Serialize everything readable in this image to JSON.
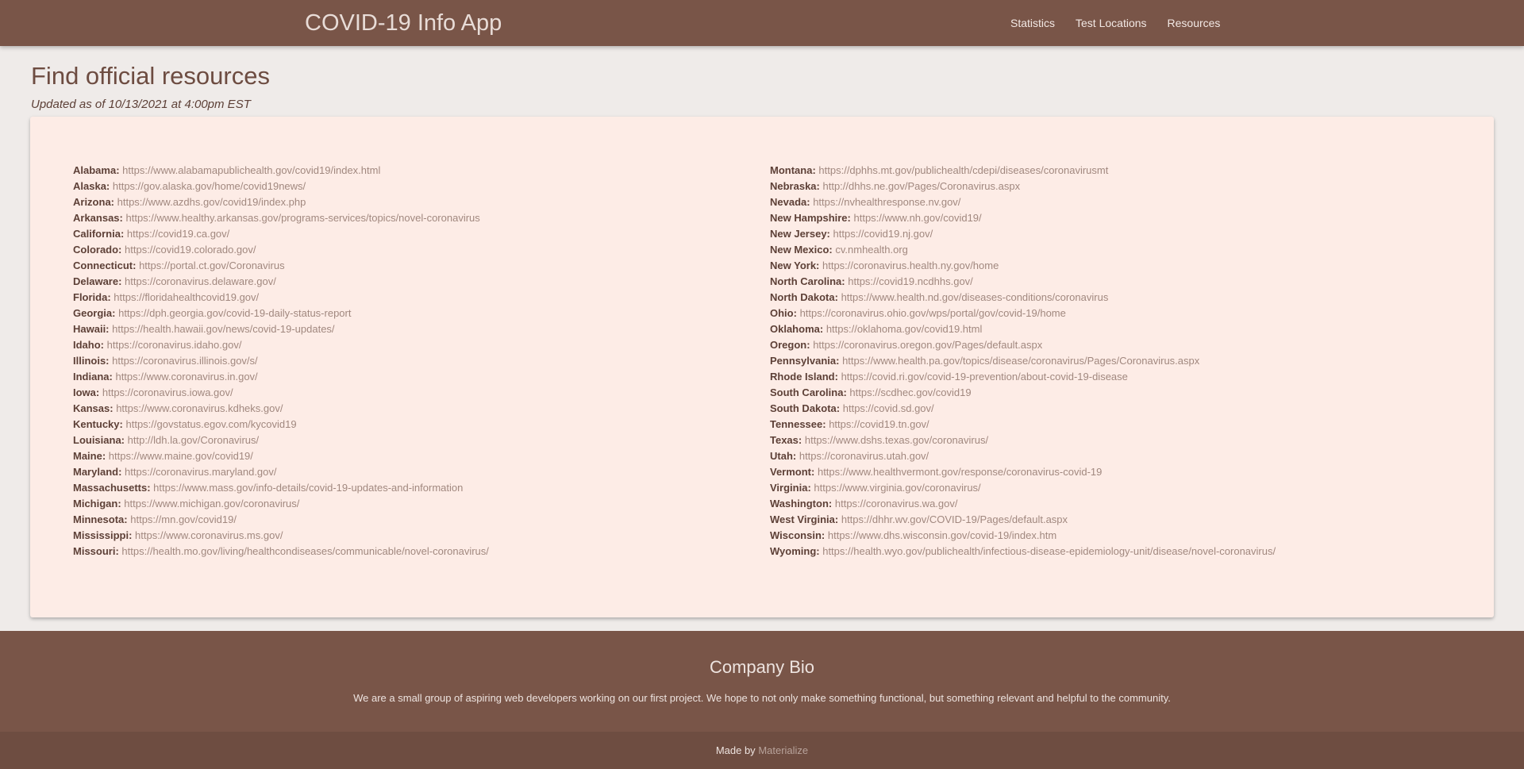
{
  "navbar": {
    "brand": "COVID-19 Info App",
    "links": [
      "Statistics",
      "Test Locations",
      "Resources"
    ]
  },
  "page": {
    "title": "Find official resources",
    "updated": "Updated as of 10/13/2021 at 4:00pm EST"
  },
  "resources": {
    "left": [
      {
        "state": "Alabama:",
        "url": "https://www.alabamapublichealth.gov/covid19/index.html"
      },
      {
        "state": "Alaska:",
        "url": "https://gov.alaska.gov/home/covid19news/"
      },
      {
        "state": "Arizona:",
        "url": "https://www.azdhs.gov/covid19/index.php"
      },
      {
        "state": "Arkansas:",
        "url": "https://www.healthy.arkansas.gov/programs-services/topics/novel-coronavirus"
      },
      {
        "state": "California:",
        "url": "https://covid19.ca.gov/"
      },
      {
        "state": "Colorado:",
        "url": "https://covid19.colorado.gov/"
      },
      {
        "state": "Connecticut:",
        "url": "https://portal.ct.gov/Coronavirus"
      },
      {
        "state": "Delaware:",
        "url": "https://coronavirus.delaware.gov/"
      },
      {
        "state": "Florida:",
        "url": "https://floridahealthcovid19.gov/"
      },
      {
        "state": "Georgia:",
        "url": "https://dph.georgia.gov/covid-19-daily-status-report"
      },
      {
        "state": "Hawaii:",
        "url": "https://health.hawaii.gov/news/covid-19-updates/"
      },
      {
        "state": "Idaho:",
        "url": "https://coronavirus.idaho.gov/"
      },
      {
        "state": "Illinois:",
        "url": "https://coronavirus.illinois.gov/s/"
      },
      {
        "state": "Indiana:",
        "url": "https://www.coronavirus.in.gov/"
      },
      {
        "state": "Iowa:",
        "url": "https://coronavirus.iowa.gov/"
      },
      {
        "state": "Kansas:",
        "url": "https://www.coronavirus.kdheks.gov/"
      },
      {
        "state": "Kentucky:",
        "url": "https://govstatus.egov.com/kycovid19"
      },
      {
        "state": "Louisiana:",
        "url": "http://ldh.la.gov/Coronavirus/"
      },
      {
        "state": "Maine:",
        "url": "https://www.maine.gov/covid19/"
      },
      {
        "state": "Maryland:",
        "url": "https://coronavirus.maryland.gov/"
      },
      {
        "state": "Massachusetts:",
        "url": "https://www.mass.gov/info-details/covid-19-updates-and-information"
      },
      {
        "state": "Michigan:",
        "url": "https://www.michigan.gov/coronavirus/"
      },
      {
        "state": "Minnesota:",
        "url": "https://mn.gov/covid19/"
      },
      {
        "state": "Mississippi:",
        "url": "https://www.coronavirus.ms.gov/"
      },
      {
        "state": "Missouri:",
        "url": "https://health.mo.gov/living/healthcondiseases/communicable/novel-coronavirus/"
      }
    ],
    "right": [
      {
        "state": "Montana:",
        "url": "https://dphhs.mt.gov/publichealth/cdepi/diseases/coronavirusmt"
      },
      {
        "state": "Nebraska:",
        "url": "http://dhhs.ne.gov/Pages/Coronavirus.aspx"
      },
      {
        "state": "Nevada:",
        "url": "https://nvhealthresponse.nv.gov/"
      },
      {
        "state": "New Hampshire:",
        "url": "https://www.nh.gov/covid19/"
      },
      {
        "state": "New Jersey:",
        "url": "https://covid19.nj.gov/"
      },
      {
        "state": "New Mexico:",
        "url": "cv.nmhealth.org"
      },
      {
        "state": "New York:",
        "url": "https://coronavirus.health.ny.gov/home"
      },
      {
        "state": "North Carolina:",
        "url": "https://covid19.ncdhhs.gov/"
      },
      {
        "state": "North Dakota:",
        "url": "https://www.health.nd.gov/diseases-conditions/coronavirus"
      },
      {
        "state": "Ohio:",
        "url": "https://coronavirus.ohio.gov/wps/portal/gov/covid-19/home"
      },
      {
        "state": "Oklahoma:",
        "url": "https://oklahoma.gov/covid19.html"
      },
      {
        "state": "Oregon:",
        "url": "https://coronavirus.oregon.gov/Pages/default.aspx"
      },
      {
        "state": "Pennsylvania:",
        "url": "https://www.health.pa.gov/topics/disease/coronavirus/Pages/Coronavirus.aspx"
      },
      {
        "state": "Rhode Island:",
        "url": "https://covid.ri.gov/covid-19-prevention/about-covid-19-disease"
      },
      {
        "state": "South Carolina:",
        "url": "https://scdhec.gov/covid19"
      },
      {
        "state": "South Dakota:",
        "url": "https://covid.sd.gov/"
      },
      {
        "state": "Tennessee:",
        "url": "https://covid19.tn.gov/"
      },
      {
        "state": "Texas:",
        "url": "https://www.dshs.texas.gov/coronavirus/"
      },
      {
        "state": "Utah:",
        "url": "https://coronavirus.utah.gov/"
      },
      {
        "state": "Vermont:",
        "url": "https://www.healthvermont.gov/response/coronavirus-covid-19"
      },
      {
        "state": "Virginia:",
        "url": "https://www.virginia.gov/coronavirus/"
      },
      {
        "state": "Washington:",
        "url": "https://coronavirus.wa.gov/"
      },
      {
        "state": "West Virginia:",
        "url": "https://dhhr.wv.gov/COVID-19/Pages/default.aspx"
      },
      {
        "state": "Wisconsin:",
        "url": "https://www.dhs.wisconsin.gov/covid-19/index.htm"
      },
      {
        "state": "Wyoming:",
        "url": "https://health.wyo.gov/publichealth/infectious-disease-epidemiology-unit/disease/novel-coronavirus/"
      }
    ]
  },
  "footer": {
    "title": "Company Bio",
    "text": "We are a small group of aspiring web developers working on our first project. We hope to not only make something functional, but something relevant and helpful to the community.",
    "made_by": "Made by",
    "made_by_link": "Materialize"
  }
}
